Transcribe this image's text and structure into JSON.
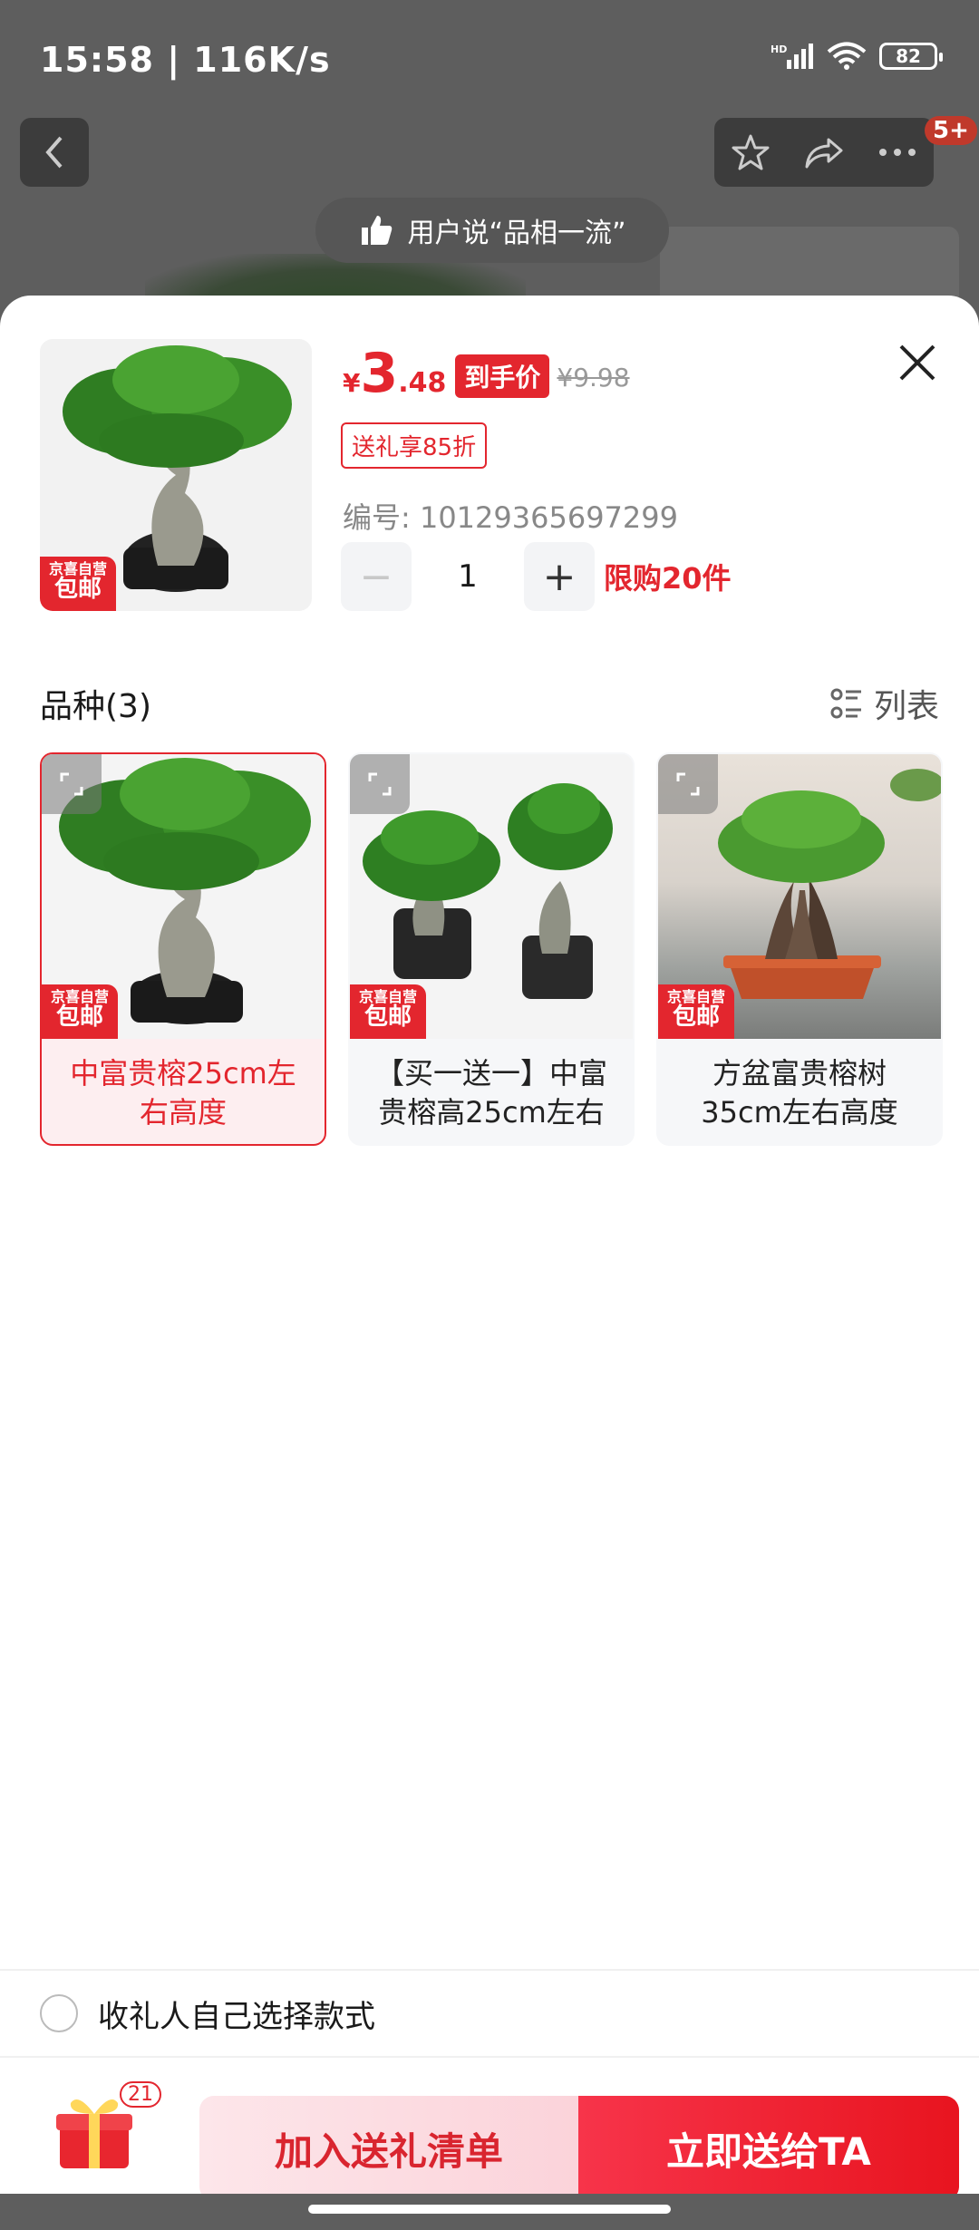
{
  "status_bar": {
    "time": "15:58 | 116K/s",
    "battery": "82"
  },
  "top_nav": {
    "badge": "5+"
  },
  "hint_banner": {
    "text": "用户说“品相一流”"
  },
  "product": {
    "currency": "¥",
    "price_int": "3",
    "price_dec": ".48",
    "price_tag": "到手价",
    "original_price": "¥9.98",
    "coupon": "送礼享85折",
    "sku_code": "编号: 10129365697299",
    "quantity": "1",
    "limit": "限购20件",
    "badge_top": "京喜自营",
    "badge_bottom": "包邮"
  },
  "variants_section": {
    "title": "品种(3)",
    "list_toggle": "列表",
    "items": [
      {
        "name": "中富贵榕25cm左右高度",
        "badge_top": "京喜自营",
        "badge_bottom": "包邮",
        "selected": true
      },
      {
        "name": "【买一送一】中富贵榕高25cm左右",
        "badge_top": "京喜自营",
        "badge_bottom": "包邮",
        "selected": false
      },
      {
        "name": "方盆富贵榕树35cm左右高度",
        "badge_top": "京喜自营",
        "badge_bottom": "包邮",
        "selected": false
      }
    ]
  },
  "self_choose": {
    "label": "收礼人自己选择款式"
  },
  "bottom_bar": {
    "gift_count": "21",
    "add_list": "加入送礼清单",
    "send_now": "立即送给TA"
  },
  "colors": {
    "accent": "#e3262e",
    "sheet": "#ffffff",
    "overlay": "#5e5e5e"
  }
}
